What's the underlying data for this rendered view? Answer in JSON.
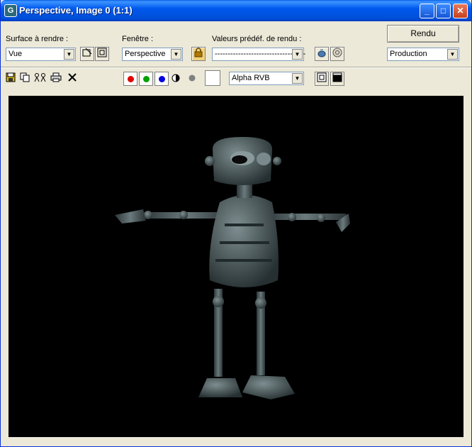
{
  "window": {
    "title": "Perspective, Image 0 (1:1)",
    "app_icon_glyph": "G",
    "minimize_glyph": "_",
    "maximize_glyph": "□",
    "close_glyph": "✕"
  },
  "controls": {
    "area_label": "Surface à rendre :",
    "area_value": "Vue",
    "viewport_label": "Fenêtre :",
    "viewport_value": "Perspective",
    "preset_label": "Valeurs prédéf. de rendu :",
    "preset_value": "-----------------------------------",
    "render_button": "Rendu",
    "mode_value": "Production",
    "dropdown_glyph": "▼"
  },
  "toolbar": {
    "channel_value": "Alpha RVB",
    "colors": {
      "red": "#e00000",
      "green": "#00a000",
      "blue": "#0000e0",
      "monochrome": "#808080",
      "background_swatch": "#ffffff",
      "viewport_bg": "#000000",
      "titlebar": "#0058ee"
    },
    "icons": [
      "save-icon",
      "copy-icon",
      "clone-icon",
      "print-icon",
      "clear-icon",
      "monochrome-icon",
      "alpha-icon"
    ]
  }
}
